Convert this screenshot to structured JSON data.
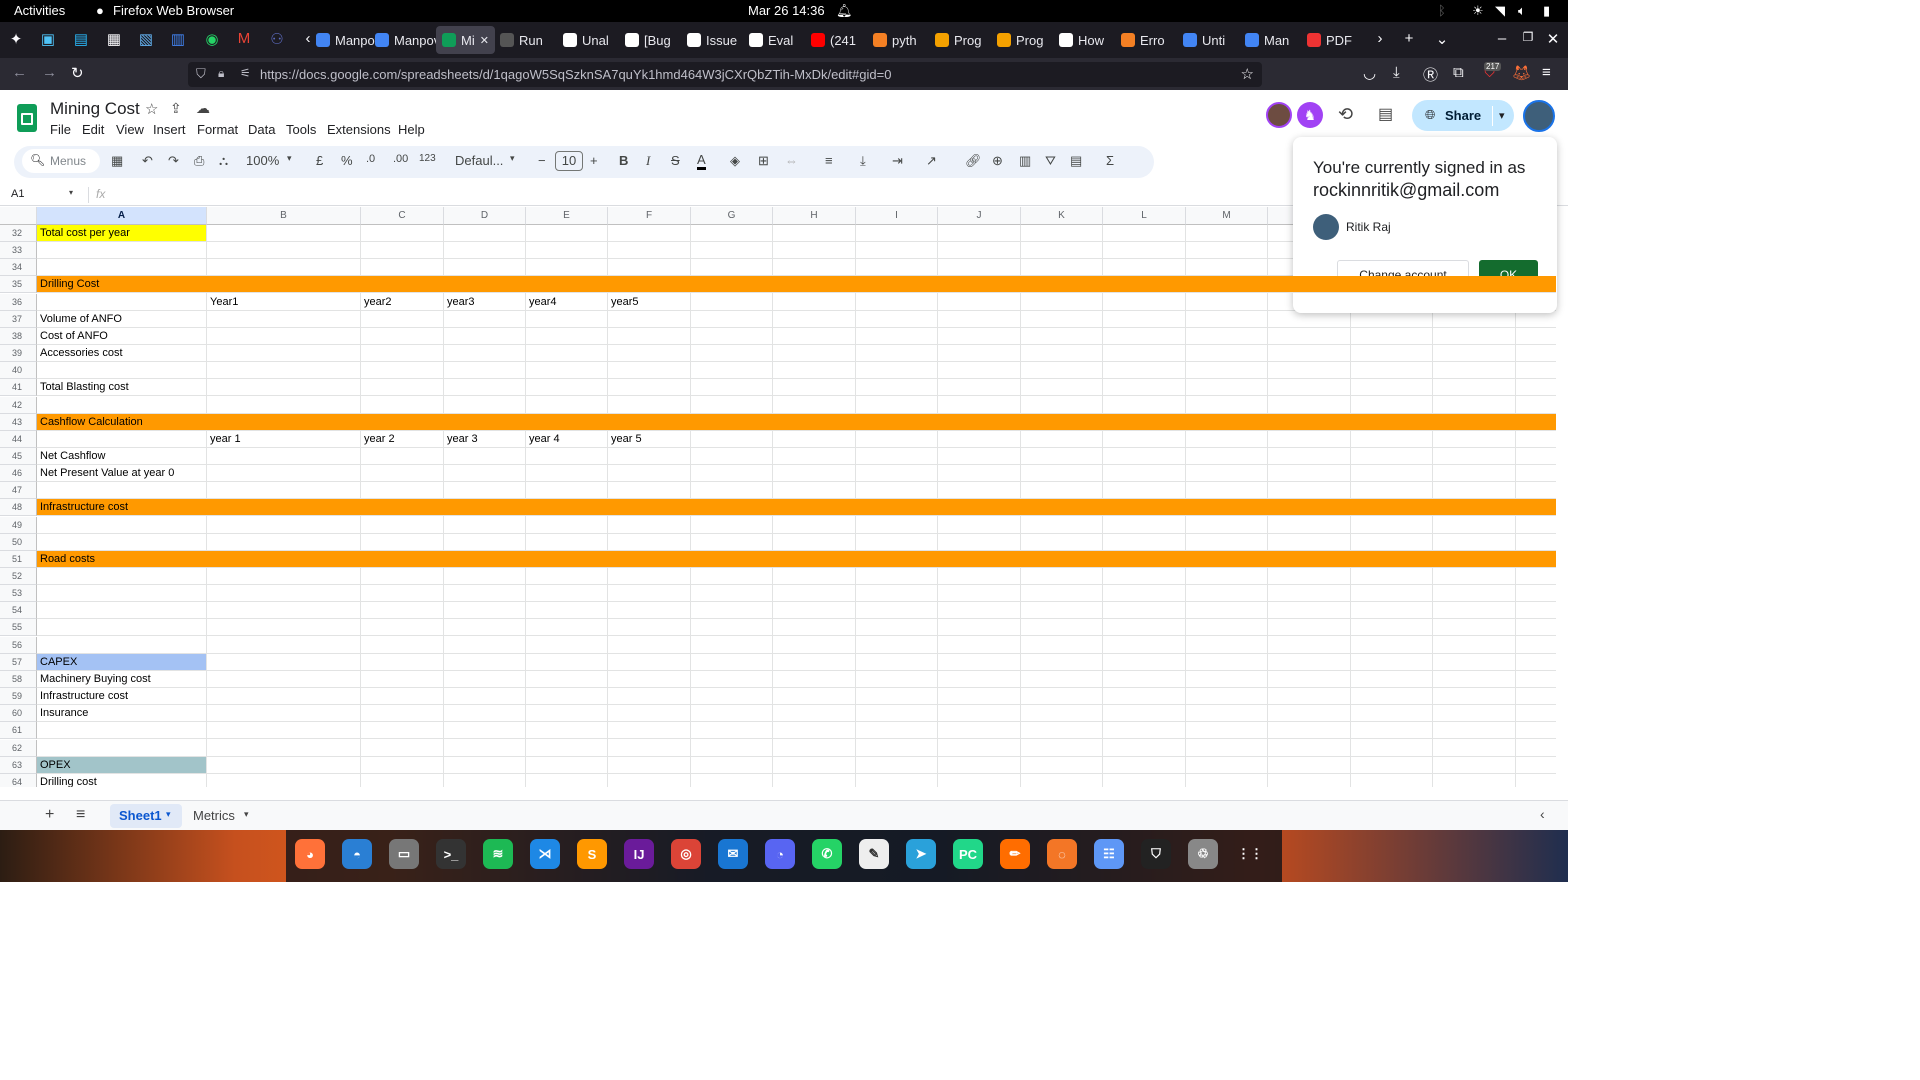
{
  "gnome": {
    "activities": "Activities",
    "app": "Firefox Web Browser",
    "datetime": "Mar 26  14:36"
  },
  "tabs": [
    {
      "label": "Manpov",
      "color": "#4285f4"
    },
    {
      "label": "Manpov",
      "color": "#4285f4"
    },
    {
      "label": "Mi",
      "color": "#0f9d58"
    },
    {
      "label": "Run",
      "color": "#555"
    },
    {
      "label": "Unal",
      "color": "#fff"
    },
    {
      "label": "[Bug",
      "color": "#fff"
    },
    {
      "label": "Issue",
      "color": "#fff"
    },
    {
      "label": "Eval",
      "color": "#fff"
    },
    {
      "label": "(241",
      "color": "#ff0000"
    },
    {
      "label": "pyth",
      "color": "#f48024"
    },
    {
      "label": "Prog",
      "color": "#f4a100"
    },
    {
      "label": "Prog",
      "color": "#f4a100"
    },
    {
      "label": "How",
      "color": "#fff"
    },
    {
      "label": "Erro",
      "color": "#f48024"
    },
    {
      "label": "Unti",
      "color": "#4285f4"
    },
    {
      "label": "Man",
      "color": "#4285f4"
    },
    {
      "label": "PDF",
      "color": "#e33"
    }
  ],
  "url": "https://docs.google.com/spreadsheets/d/1qagoW5SqSzknSA7quYk1hmd464W3jCXrQbZTih-MxDk/edit#gid=0",
  "extension_badge": "217",
  "sheet": {
    "title": "Mining Cost",
    "menus": [
      "File",
      "Edit",
      "View",
      "Insert",
      "Format",
      "Data",
      "Tools",
      "Extensions",
      "Help"
    ],
    "search_placeholder": "Menus",
    "zoom": "100%",
    "currency": "£",
    "percent": "%",
    "dec_minus": ".0",
    "dec_plus": ".00",
    "number_format": "123",
    "font": "Defaul...",
    "font_size": "10",
    "share_label": "Share",
    "cell_ref": "A1",
    "fx": "fx"
  },
  "columns": [
    "A",
    "B",
    "C",
    "D",
    "E",
    "F",
    "G",
    "H",
    "I",
    "J",
    "K",
    "L",
    "M"
  ],
  "rows": [
    {
      "n": "32",
      "a": "Total cost per year",
      "fill": "a-yellow"
    },
    {
      "n": "33",
      "a": ""
    },
    {
      "n": "34",
      "a": ""
    },
    {
      "n": "35",
      "a": "Drilling Cost",
      "fill": "orange"
    },
    {
      "n": "36",
      "a": "",
      "b": "Year1",
      "c": "year2",
      "d": "year3",
      "e": "year4",
      "f": "year5"
    },
    {
      "n": "37",
      "a": "Volume of ANFO"
    },
    {
      "n": "38",
      "a": "Cost of ANFO"
    },
    {
      "n": "39",
      "a": "Accessories cost"
    },
    {
      "n": "40",
      "a": ""
    },
    {
      "n": "41",
      "a": "Total Blasting cost"
    },
    {
      "n": "42",
      "a": ""
    },
    {
      "n": "43",
      "a": "Cashflow Calculation",
      "fill": "orange"
    },
    {
      "n": "44",
      "a": "",
      "b": "year 1",
      "c": "year 2",
      "d": "year 3",
      "e": "year 4",
      "f": "year 5"
    },
    {
      "n": "45",
      "a": "Net Cashflow"
    },
    {
      "n": "46",
      "a": "Net Present Value at year 0"
    },
    {
      "n": "47",
      "a": ""
    },
    {
      "n": "48",
      "a": "Infrastructure cost",
      "fill": "orange"
    },
    {
      "n": "49",
      "a": ""
    },
    {
      "n": "50",
      "a": ""
    },
    {
      "n": "51",
      "a": "Road costs",
      "fill": "orange"
    },
    {
      "n": "52",
      "a": ""
    },
    {
      "n": "53",
      "a": ""
    },
    {
      "n": "54",
      "a": ""
    },
    {
      "n": "55",
      "a": ""
    },
    {
      "n": "56",
      "a": ""
    },
    {
      "n": "57",
      "a": "CAPEX",
      "fill": "a-blue"
    },
    {
      "n": "58",
      "a": "Machinery Buying cost"
    },
    {
      "n": "59",
      "a": "Infrastructure cost"
    },
    {
      "n": "60",
      "a": "Insurance"
    },
    {
      "n": "61",
      "a": ""
    },
    {
      "n": "62",
      "a": ""
    },
    {
      "n": "63",
      "a": "OPEX",
      "fill": "a-teal"
    },
    {
      "n": "64",
      "a": "Drilling cost"
    }
  ],
  "colors": {
    "orange": "#ff9900",
    "yellow": "#ffff00",
    "blue": "#a4c2f4",
    "teal": "#a2c4c9",
    "selected_header": "#d3e3fd",
    "green": "#146c2e"
  },
  "popup": {
    "line1": "You're currently signed in as",
    "email": "rockinnritik@gmail.com",
    "name": "Ritik Raj",
    "change": "Change account",
    "ok": "OK"
  },
  "sheet_tabs": [
    "Sheet1",
    "Metrics"
  ],
  "dock": [
    "firefox",
    "thunderbird",
    "files",
    "terminal",
    "spotify",
    "vscode",
    "sublime",
    "intellij",
    "chrome",
    "bluemail",
    "discord",
    "whatsapp",
    "texteditor",
    "telegram",
    "pycharm",
    "drawing",
    "jupyter",
    "chat",
    "vpn",
    "trash",
    "apps"
  ]
}
